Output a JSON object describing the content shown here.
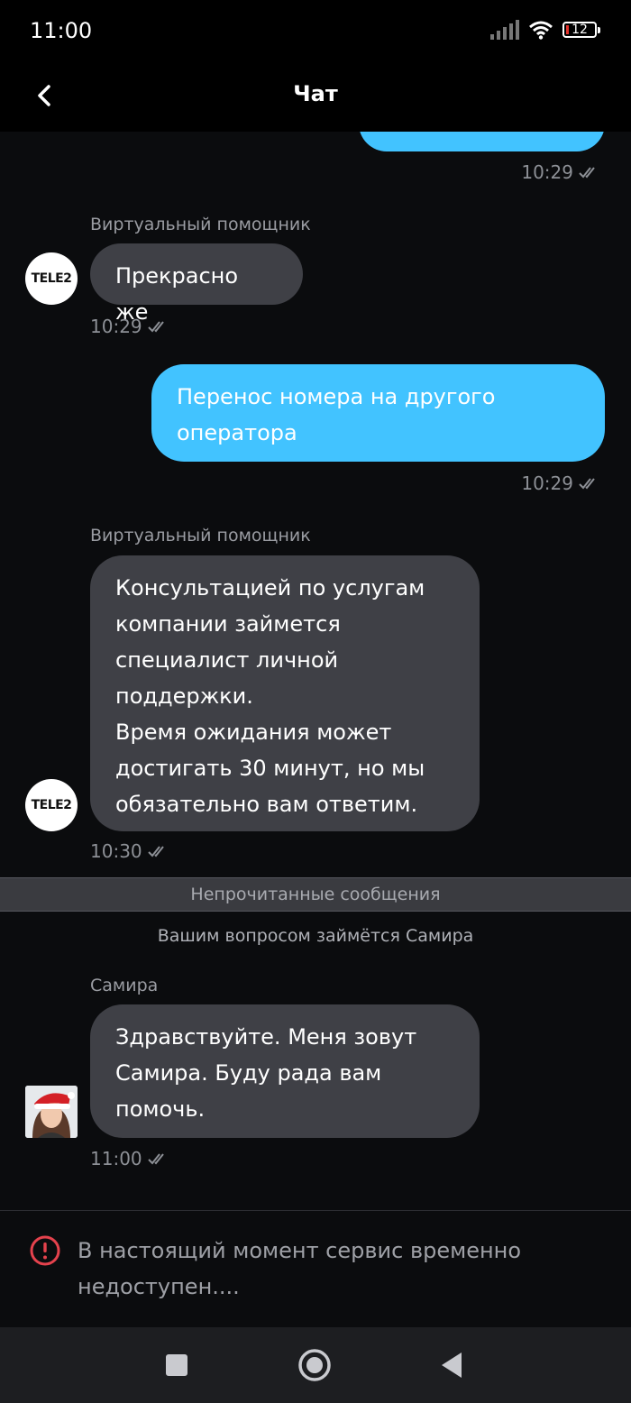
{
  "status_bar": {
    "time": "11:00",
    "battery": "12",
    "icons": [
      "signal-icon",
      "wifi-icon",
      "battery-icon"
    ]
  },
  "header": {
    "title": "Чат",
    "back_icon": "chevron-left-icon"
  },
  "messages": [
    {
      "id": "m0",
      "direction": "out",
      "text": "",
      "time": "10:29"
    },
    {
      "id": "m1",
      "direction": "in",
      "sender": "Виртуальный помощник",
      "text": "Прекрасно же",
      "time": "10:29"
    },
    {
      "id": "m2",
      "direction": "out",
      "lines": [
        "Перенос номера на другого",
        "оператора"
      ],
      "time": "10:29"
    },
    {
      "id": "m3",
      "direction": "in",
      "sender": "Виртуальный помощник",
      "lines": [
        "Консультацией по услугам",
        "компании займется",
        "специалист личной",
        "поддержки.",
        "Время ожидания может",
        "достигать 30 минут, но мы",
        "обязательно вам ответим."
      ],
      "time": "10:30"
    },
    {
      "id": "m4",
      "direction": "in",
      "sender": "Самира",
      "lines": [
        "Здравствуйте. Меня зовут",
        "Самира. Буду рада вам",
        "помочь."
      ],
      "time": "11:00"
    }
  ],
  "divider": {
    "label": "Непрочитанные сообщения"
  },
  "system_message": "Вашим вопросом займётся Самира",
  "avatar_logo": "TELE2",
  "notice": {
    "lines": [
      "В настоящий момент сервис временно",
      "недоступен...."
    ],
    "icon": "alert-circle-icon",
    "color": "#e5424d"
  },
  "colors": {
    "outgoing": "#42c3ff",
    "incoming": "#3f4046",
    "background": "#0b0c0e"
  },
  "nav": {
    "icons": [
      "square-icon",
      "circle-home-icon",
      "triangle-back-icon"
    ]
  }
}
